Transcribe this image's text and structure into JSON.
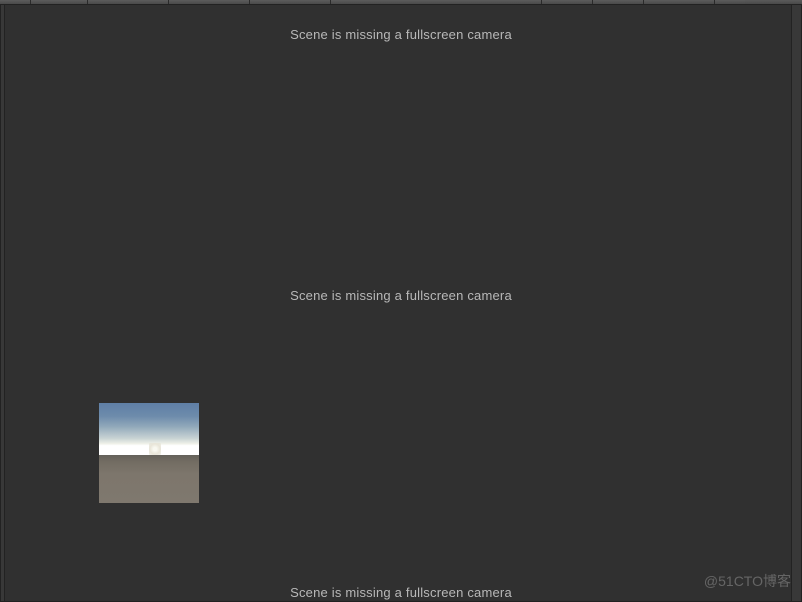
{
  "warnings": {
    "missing_camera_1": "Scene is missing a fullscreen camera",
    "missing_camera_2": "Scene is missing a fullscreen camera",
    "missing_camera_3": "Scene is missing a fullscreen camera"
  },
  "watermark": "@51CTO博客",
  "toolbar_segments": [
    30,
    56,
    80,
    80,
    80,
    210,
    50,
    50,
    70,
    30
  ]
}
